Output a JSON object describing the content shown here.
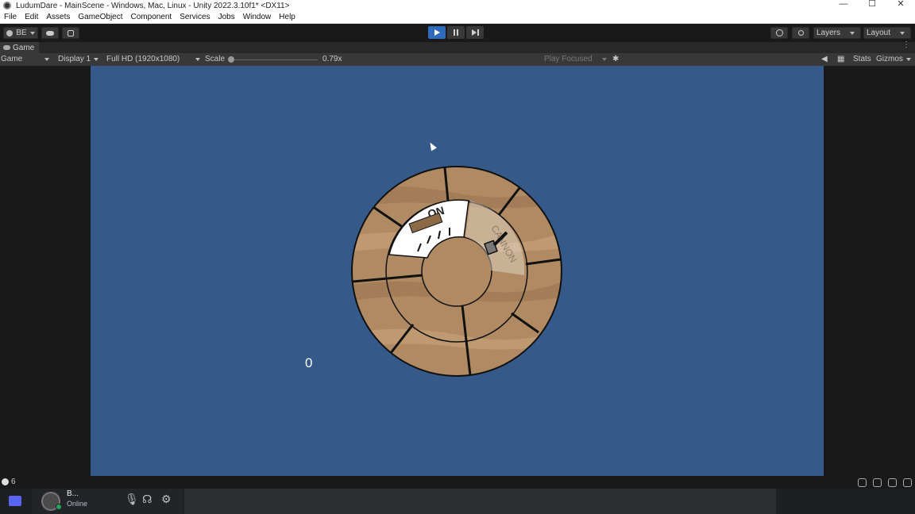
{
  "window": {
    "title": "LudumDare - MainScene - Windows, Mac, Linux - Unity 2022.3.10f1* <DX11>",
    "controls": {
      "minimize": "—",
      "maximize": "☐",
      "close": "✕"
    }
  },
  "menu": [
    "File",
    "Edit",
    "Assets",
    "GameObject",
    "Component",
    "Services",
    "Jobs",
    "Window",
    "Help"
  ],
  "toolbar": {
    "account": "BE",
    "layers": "Layers",
    "layout": "Layout",
    "play_state": "playing"
  },
  "tab": {
    "label": "Game"
  },
  "game_bar": {
    "view": "Game",
    "display": "Display 1",
    "resolution": "Full HD (1920x1080)",
    "scale_label": "Scale",
    "scale_value": "0.79x",
    "play_mode": "Play Focused",
    "stats": "Stats",
    "gizmos": "Gizmos"
  },
  "game": {
    "score": "0",
    "background_color": "#355a8a",
    "dial_labels": {
      "active": "ON",
      "faded": "CANNON"
    }
  },
  "status_bar": {
    "count": "6"
  },
  "taskbar": {
    "user_name": "B...",
    "user_status": "Online",
    "icons": [
      "mic-icon",
      "headphones-icon",
      "settings-icon"
    ]
  }
}
